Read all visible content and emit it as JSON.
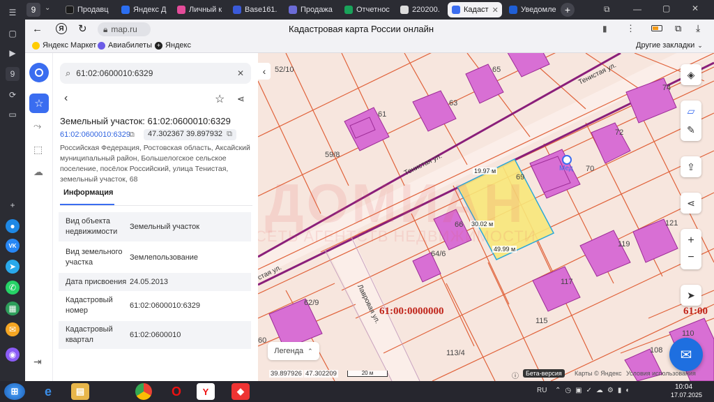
{
  "browser": {
    "tab_counter": "9",
    "tabs": [
      {
        "label": "Продавц",
        "active": false
      },
      {
        "label": "Яндекс Д",
        "active": false
      },
      {
        "label": "Личный к",
        "active": false
      },
      {
        "label": "Base161.",
        "active": false
      },
      {
        "label": "Продажа",
        "active": false
      },
      {
        "label": "Отчетнос",
        "active": false
      },
      {
        "label": "220200.",
        "active": false
      },
      {
        "label": "Кадаст",
        "active": true
      },
      {
        "label": "Уведомле",
        "active": false
      }
    ],
    "url": "map.ru",
    "page_title": "Кадастровая карта России онлайн",
    "bookmarks": [
      "Яндекс Маркет",
      "Авиабилеты",
      "Яндекс"
    ],
    "other_bookmarks": "Другие закладки"
  },
  "panel": {
    "search_value": "61:02:0600010:6329",
    "title": "Земельный участок: 61:02:0600010:6329",
    "cad_number_link": "61:02:0600010:6329",
    "coords": "47.302367 39.897932",
    "address": "Российская Федерация, Ростовская область, Аксайский муниципальный район, Большелогское сельское поселение, посёлок Российский, улица Тенистая, земельный участок, 68",
    "tab_info": "Информация",
    "rows": [
      {
        "key": "Вид объекта недвижимости",
        "value": "Земельный участок"
      },
      {
        "key": "Вид земельного участка",
        "value": "Землепользование"
      },
      {
        "key": "Дата присвоения",
        "value": "24.05.2013"
      },
      {
        "key": "Кадастровый номер",
        "value": "61:02:0600010:6329"
      },
      {
        "key": "Кадастровый квартал",
        "value": "61:02:0600010"
      }
    ]
  },
  "map": {
    "street_tenistaya_1": "Тенистая ул.",
    "street_tenistaya_2": "Тенистая ул.",
    "street_tenistaya_3": "стая ул.",
    "street_lavrovaya": "Лавровая ул.",
    "parcel_labels": [
      "52/10",
      "65",
      "74",
      "61",
      "63",
      "72",
      "59/8",
      "69",
      "70",
      "66",
      "64/6",
      "119",
      "121",
      "117",
      "115",
      "62/9",
      "60",
      "113/4",
      "108",
      "110"
    ],
    "quarter_label": "61:00:0000000",
    "quarter_label_right": "61:00",
    "dim_top": "19.97 м",
    "dim_left": "30.02 м",
    "dim_bottom": "49.99 м",
    "poi_label": "Мед",
    "watermark_main": "ДОМИАН",
    "watermark_sub": "СЕТЬ АГЕНТСТВ НЕДВИЖИМОСТИ",
    "legend": "Легенда",
    "bottom_coords_lon": "39.897926",
    "bottom_coords_lat": "47.302209",
    "scale": "20 м",
    "beta": "Бета-версия",
    "attribution": "Карты © Яндекс",
    "terms": "Условия использования"
  },
  "taskbar": {
    "lang": "RU",
    "time": "10:04",
    "date": "17.07.2025"
  },
  "colors": {
    "parcel_line": "#e0623a",
    "building_fill": "#d86fd4",
    "road_line": "#8a1f7a",
    "selected_fill": "#f7e77a",
    "accent": "#3a6df0"
  }
}
